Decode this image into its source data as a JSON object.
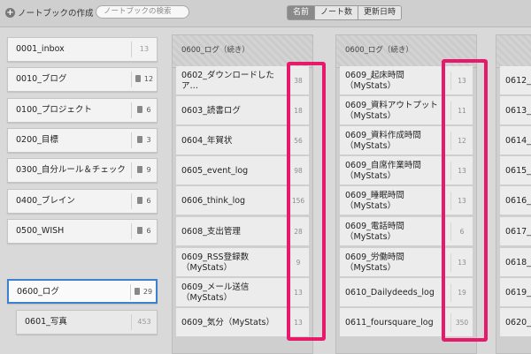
{
  "toolbar": {
    "new_notebook": "ノートブックの作成",
    "search_placeholder": "ノートブックの検索",
    "sort": [
      "名前",
      "ノート数",
      "更新日時"
    ]
  },
  "notebooks": [
    {
      "label": "0001_inbox",
      "count": "13"
    },
    {
      "label": "0010_ブログ",
      "count": "12"
    },
    {
      "label": "0100_プロジェクト",
      "count": "6"
    },
    {
      "label": "0200_目標",
      "count": "3"
    },
    {
      "label": "0300_自分ルール＆チェック…",
      "count": "9"
    },
    {
      "label": "0400_ブレイン",
      "count": "6"
    },
    {
      "label": "0500_WISH",
      "count": "6"
    },
    {
      "label": "0600_ログ",
      "count": "29"
    },
    {
      "label": "0601_写真",
      "count": "453"
    }
  ],
  "columns": [
    {
      "header": "0600_ログ（続き）",
      "notes": [
        {
          "title": "0602_ダウンロードしたア…",
          "count": "38"
        },
        {
          "title": "0603_読書ログ",
          "count": "18"
        },
        {
          "title": "0604_年賀状",
          "count": "56"
        },
        {
          "title": "0605_event_log",
          "count": "98"
        },
        {
          "title": "0606_think_log",
          "count": "156"
        },
        {
          "title": "0608_支出管理",
          "count": "28"
        },
        {
          "title": "0609_RSS登録数（MyStats）",
          "count": "9"
        },
        {
          "title": "0609_メール送信（MyStats）",
          "count": "13"
        },
        {
          "title": "0609_気分（MyStats）",
          "count": "13"
        }
      ]
    },
    {
      "header": "0600_ログ（続き）",
      "notes": [
        {
          "title": "0609_起床時間（MyStats）",
          "count": "13"
        },
        {
          "title": "0609_資料アウトプット（MyStats）",
          "count": "11"
        },
        {
          "title": "0609_資料作成時間（MyStats）",
          "count": "12"
        },
        {
          "title": "0609_自席作業時間（MyStats）",
          "count": "13"
        },
        {
          "title": "0609_睡眠時間（MyStats）",
          "count": "13"
        },
        {
          "title": "0609_電話時間（MyStats）",
          "count": "6"
        },
        {
          "title": "0609_労働時間（MyStats）",
          "count": "13"
        },
        {
          "title": "0610_Dailydeeds_log",
          "count": "19"
        },
        {
          "title": "0611_foursquare_log",
          "count": "350"
        }
      ]
    },
    {
      "header": "",
      "notes": [
        {
          "title": "0612_r",
          "count": ""
        },
        {
          "title": "0613_t",
          "count": ""
        },
        {
          "title": "0614_b",
          "count": ""
        },
        {
          "title": "0615_f",
          "count": ""
        },
        {
          "title": "0616_f",
          "count": ""
        },
        {
          "title": "0617_",
          "count": ""
        },
        {
          "title": "0618_h",
          "count": ""
        },
        {
          "title": "0619_",
          "count": ""
        },
        {
          "title": "0620_l",
          "count": ""
        }
      ]
    }
  ],
  "colors": {
    "highlight": "#e7196a",
    "selected_border": "#3f7fcf"
  }
}
